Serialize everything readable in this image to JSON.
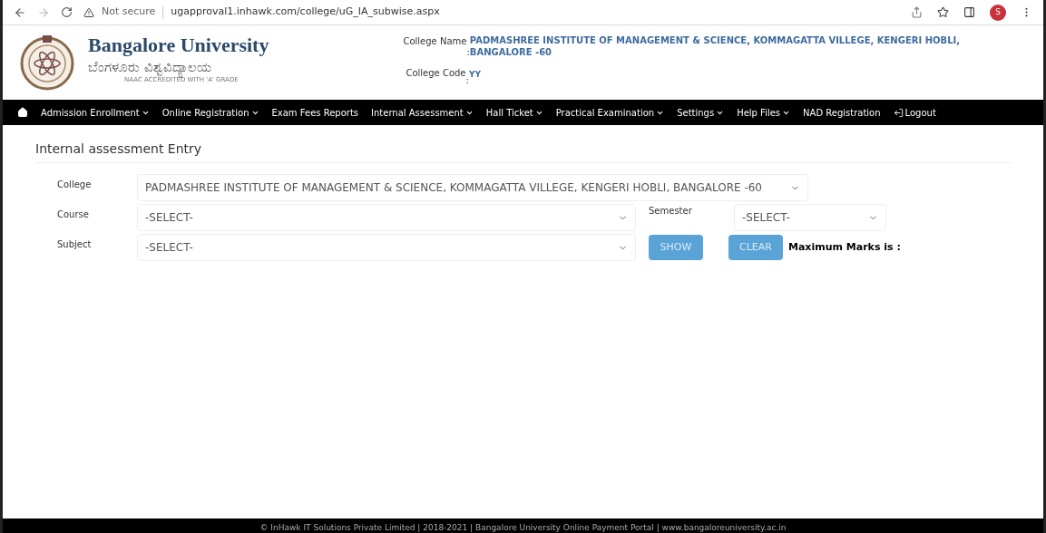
{
  "browser": {
    "security": "Not secure",
    "url": "ugapproval1.inhawk.com/college/uG_IA_subwise.aspx",
    "profile_initial": "S"
  },
  "header": {
    "title": "Bangalore University",
    "subtitle": "ಬೆಂಗಳೂರು ವಿಶ್ವವಿದ್ಯಾಲಯ",
    "tagline": "NAAC ACCREDITED WITH 'A' GRADE",
    "college_name_label": "College Name",
    "college_name_sep": ":",
    "college_name": "PADMASHREE INSTITUTE OF MANAGEMENT & SCIENCE, KOMMAGATTA VILLEGE, KENGERI HOBLI, BANGALORE -60",
    "college_code_label": "College Code",
    "college_code_sep": ":",
    "college_code": "YY"
  },
  "nav": [
    {
      "label": "Admission Enrollment",
      "dropdown": true
    },
    {
      "label": "Online Registration",
      "dropdown": true
    },
    {
      "label": "Exam Fees Reports",
      "dropdown": false
    },
    {
      "label": "Internal Assessment",
      "dropdown": true
    },
    {
      "label": "Hall Ticket",
      "dropdown": true
    },
    {
      "label": "Practical Examination",
      "dropdown": true
    },
    {
      "label": "Settings",
      "dropdown": true
    },
    {
      "label": "Help Files",
      "dropdown": true
    },
    {
      "label": "NAD Registration",
      "dropdown": false
    }
  ],
  "logout": "Logout",
  "page_title": "Internal assessment Entry",
  "form": {
    "college_label": "College",
    "college_value": "PADMASHREE INSTITUTE OF MANAGEMENT & SCIENCE, KOMMAGATTA VILLEGE, KENGERI HOBLI, BANGALORE -60",
    "course_label": "Course",
    "course_value": "-SELECT-",
    "semester_label": "Semester",
    "semester_value": "-SELECT-",
    "subject_label": "Subject",
    "subject_value": "-SELECT-",
    "show_button": "SHOW",
    "clear_button": "CLEAR",
    "max_marks": "Maximum Marks is :"
  },
  "footer": "© InHawk IT Solutions Private Limited | 2018-2021 | Bangalore University Online Payment Portal | www.bangaloreuniversity.ac.in"
}
